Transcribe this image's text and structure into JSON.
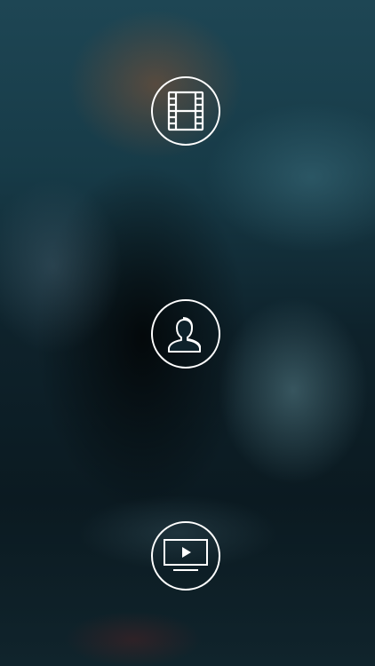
{
  "background": {
    "style": "blurred-photo",
    "dominant_colors": [
      "#1e4654",
      "#0b1a21",
      "#78503a"
    ]
  },
  "menu": {
    "items": [
      {
        "name": "movies-button",
        "icon": "film-strip-icon"
      },
      {
        "name": "people-button",
        "icon": "people-icon"
      },
      {
        "name": "tv-button",
        "icon": "tv-play-icon"
      }
    ]
  },
  "colors": {
    "icon_stroke": "#ffffff"
  }
}
